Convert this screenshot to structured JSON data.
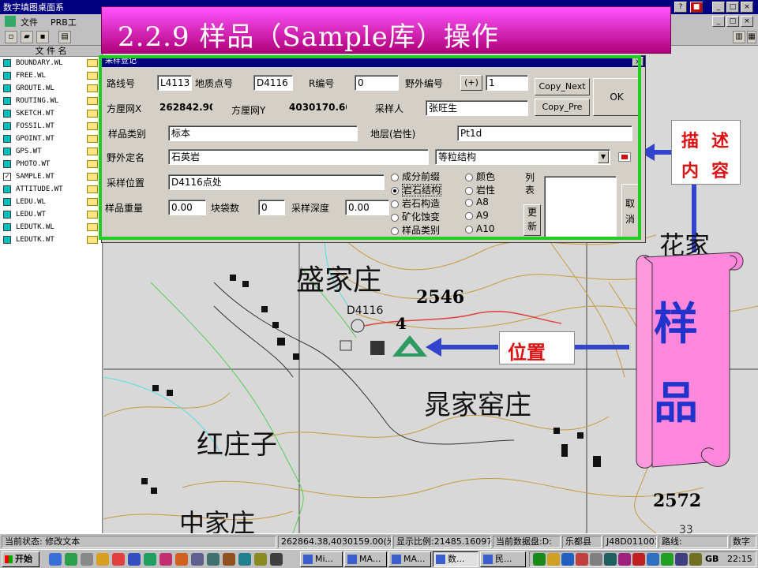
{
  "window": {
    "title": "数字填图桌面系"
  },
  "menu": {
    "file": "文件",
    "prb": "PRB工"
  },
  "slide_title": "2.2.9  样品（Sample库）操作",
  "layer_panel": {
    "header": "文 件 名",
    "layers": [
      {
        "name": "BOUNDARY.WL",
        "checked": false
      },
      {
        "name": "FREE.WL",
        "checked": false
      },
      {
        "name": "GROUTE.WL",
        "checked": false
      },
      {
        "name": "ROUTING.WL",
        "checked": false
      },
      {
        "name": "SKETCH.WT",
        "checked": false
      },
      {
        "name": "FOSSIL.WT",
        "checked": false
      },
      {
        "name": "GPOINT.WT",
        "checked": false
      },
      {
        "name": "GPS.WT",
        "checked": false
      },
      {
        "name": "PHOTO.WT",
        "checked": false
      },
      {
        "name": "SAMPLE.WT",
        "checked": true
      },
      {
        "name": "ATTITUDE.WT",
        "checked": false
      },
      {
        "name": "LEDU.WL",
        "checked": false
      },
      {
        "name": "LEDU.WT",
        "checked": false
      },
      {
        "name": "LEDUTK.WL",
        "checked": false
      },
      {
        "name": "LEDUTK.WT",
        "checked": false
      }
    ]
  },
  "dialog": {
    "title": "采样登记",
    "route_label": "路线号",
    "route_value": "L4113",
    "gpoint_label": "地质点号",
    "gpoint_value": "D4116",
    "r_label": "R编号",
    "r_value": "0",
    "field_no_label": "野外编号",
    "field_no_btn": "(+)",
    "field_no_value": "1",
    "copy_next": "Copy_Next",
    "copy_pre": "Copy_Pre",
    "ok": "OK",
    "cancel": "取消",
    "x_label": "方厘网X",
    "x_value": "262842.90",
    "y_label": "方厘网Y",
    "y_value": "4030170.60",
    "sampler_label": "采样人",
    "sampler_value": "张旺生",
    "category_label": "样品类别",
    "category_value": "标本",
    "stratum_label": "地层(岩性)",
    "stratum_value": "Pt1d",
    "field_name_label": "野外定名",
    "field_name_value": "石英岩",
    "texture_value": "等粒结构",
    "location_label": "采样位置",
    "location_value": "D4116点处",
    "weight_label": "样品重量",
    "weight_value": "0.00",
    "bags_label": "块袋数",
    "bags_value": "0",
    "depth_label": "采样深度",
    "depth_value": "0.00",
    "radios_col1": [
      "成分前缀",
      "岩石结构",
      "岩石构造",
      "矿化蚀变",
      "样品类别"
    ],
    "radios_col2": [
      "颜色",
      "岩性",
      "A8",
      "A9",
      "A10"
    ],
    "selected_radio": "岩石结构",
    "list_label": "列表",
    "update_btn": "更新"
  },
  "map": {
    "place_names": [
      "盛家庄",
      "晁家窑庄",
      "红庄子",
      "花家",
      "中家庄"
    ],
    "point_label": "D4116",
    "point_number": "4",
    "elevation_1": "2546",
    "elevation_2": "2572"
  },
  "annotations": {
    "describe": [
      "描",
      "述",
      "内",
      "容"
    ],
    "position": "位置",
    "sample": [
      "样",
      "品"
    ],
    "page_number": "33"
  },
  "statusbar": {
    "state": "当前状态:  修改文本",
    "coords": "262864.38,4030159.00(米)",
    "scale": "显示比例:21485.160970",
    "disk": "当前数据盘:D:",
    "county": "乐都县",
    "sheet": "J48D011001",
    "route": "路线:",
    "mode": "数字"
  },
  "taskbar": {
    "start": "开始",
    "tasks": [
      "Mi...",
      "MA...",
      "MA...",
      "数...",
      "民..."
    ],
    "tray_text": "GB",
    "clock": "22:15"
  },
  "colors": {
    "title_bar": "#000080",
    "highlight": "#22cc22",
    "slide_title": "#d020a0",
    "scroll": "#ff88dd",
    "annotation_text": "#dd1111",
    "arrow": "#3344cc"
  }
}
